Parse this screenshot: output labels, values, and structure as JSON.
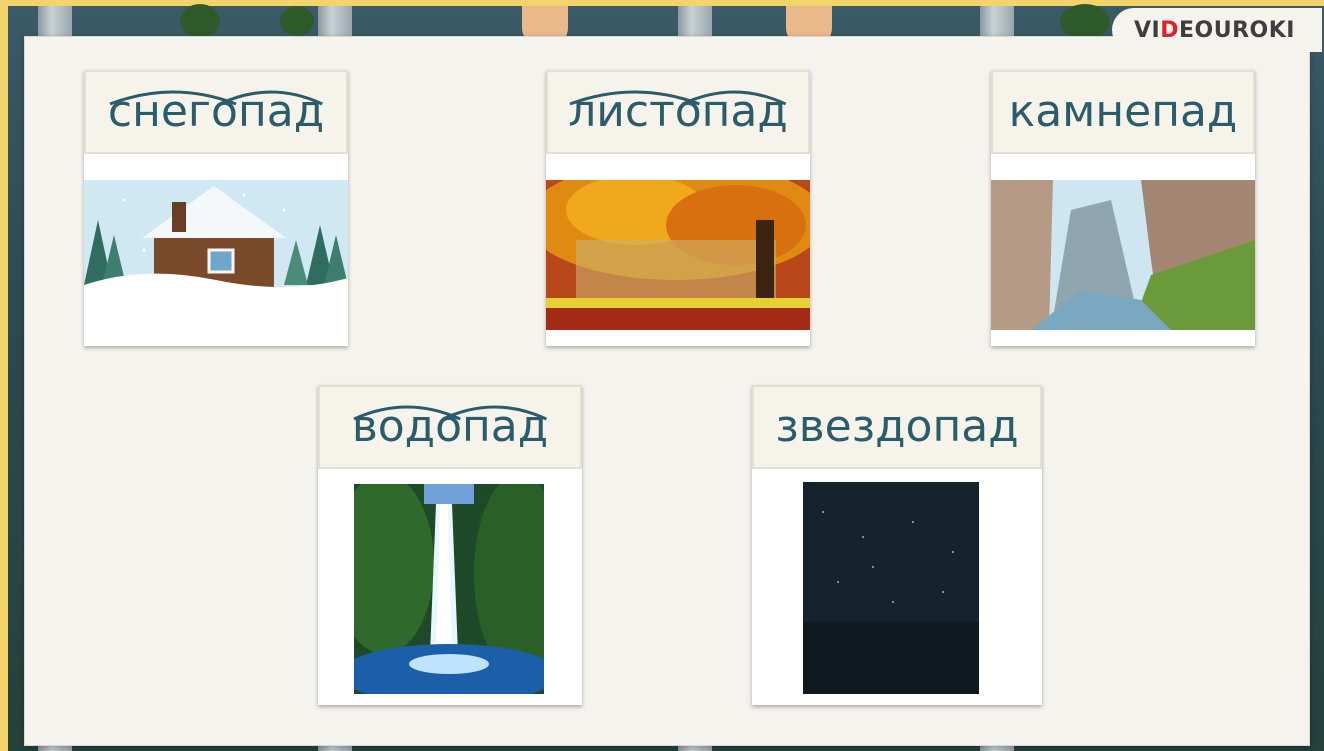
{
  "logo": {
    "part1": "VI",
    "part2": "D",
    "part3": "EOUROKI"
  },
  "cards": [
    {
      "word": "снегопад",
      "image": "winter-house-snowfall"
    },
    {
      "word": "листопад",
      "image": "autumn-tree-leaf-fall"
    },
    {
      "word": "камнепад",
      "image": "rocky-canyon-rockfall"
    },
    {
      "word": "водопад",
      "image": "jungle-waterfall"
    },
    {
      "word": "звездопад",
      "image": "night-sky-stars"
    }
  ]
}
